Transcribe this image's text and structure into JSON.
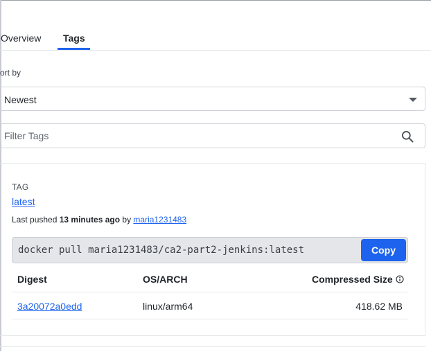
{
  "tabs": [
    {
      "label": "Overview"
    },
    {
      "label": "Tags"
    }
  ],
  "sort": {
    "label": "ort by",
    "selected": "Newest"
  },
  "filter": {
    "placeholder": "Filter Tags",
    "value": ""
  },
  "tag_card": {
    "heading": "TAG",
    "tag_name": "latest",
    "last_pushed_prefix": "Last pushed ",
    "last_pushed_time": "13 minutes ago",
    "last_pushed_by": " by ",
    "pushed_by_user": "maria1231483",
    "pull_command": "docker pull maria1231483/ca2-part2-jenkins:latest",
    "copy_label": "Copy",
    "table": {
      "headers": {
        "digest": "Digest",
        "os_arch": "OS/ARCH",
        "size": "Compressed Size"
      },
      "rows": [
        {
          "digest": "3a20072a0edd",
          "os_arch": "linux/arm64",
          "size": "418.62 MB"
        }
      ]
    }
  },
  "colors": {
    "accent": "#1d63ed",
    "pull_box_bg": "#e4e6ea"
  },
  "icons": {
    "sort_caret": "chevron-down-icon",
    "search": "search-icon",
    "info": "info-icon"
  }
}
